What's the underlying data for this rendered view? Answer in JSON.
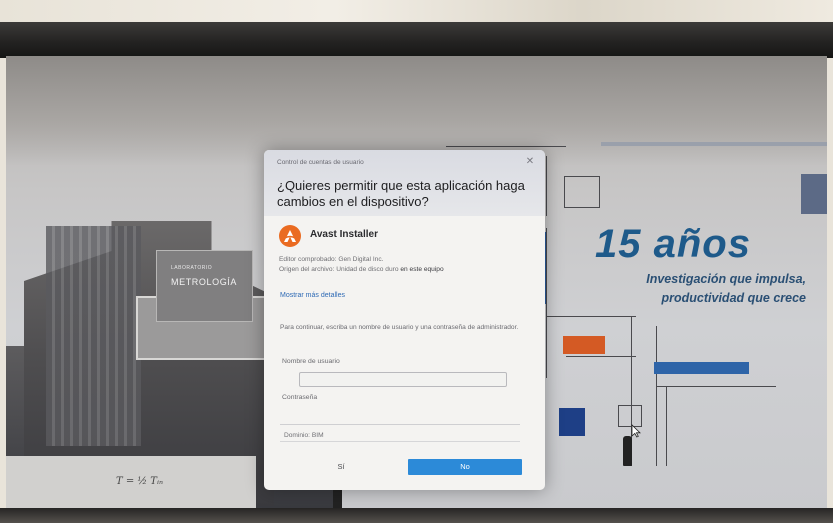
{
  "uac": {
    "title_bar": "Control de cuentas de usuario",
    "question": "¿Quieres permitir que esta aplicación haga cambios en el dispositivo?",
    "app_name": "Avast Installer",
    "publisher_label": "Editor comprobado:",
    "publisher": "Gen Digital Inc.",
    "origin_label": "Origen del archivo:",
    "origin_value": "Unidad de disco duro",
    "origin_location": "en este equipo",
    "show_more": "Mostrar más detalles",
    "instruction": "Para continuar, escriba un nombre de usuario y una contraseña de administrador.",
    "username_label": "Nombre de usuario",
    "username_value": "",
    "password_label": "Contraseña",
    "password_value": "",
    "domain_text": "Dominio: BIM",
    "yes_label": "Sí",
    "no_label": "No"
  },
  "background": {
    "anniversary_title": "15 años",
    "anniversary_line1": "Investigación que impulsa,",
    "anniversary_line2": "productividad que crece",
    "building_sign_small": "LABORATORIO",
    "building_sign_main": "METROLOGÍA",
    "formula": "T = ½ Tᵢₙ"
  },
  "colors": {
    "accent_button": "#2c8ad8",
    "avast_orange": "#ea6b21",
    "anniversary_blue": "#1e5a8a"
  },
  "icons": {
    "app_icon": "avast-logo-icon",
    "close_icon": "close-icon",
    "cursor": "mouse-cursor-icon"
  }
}
